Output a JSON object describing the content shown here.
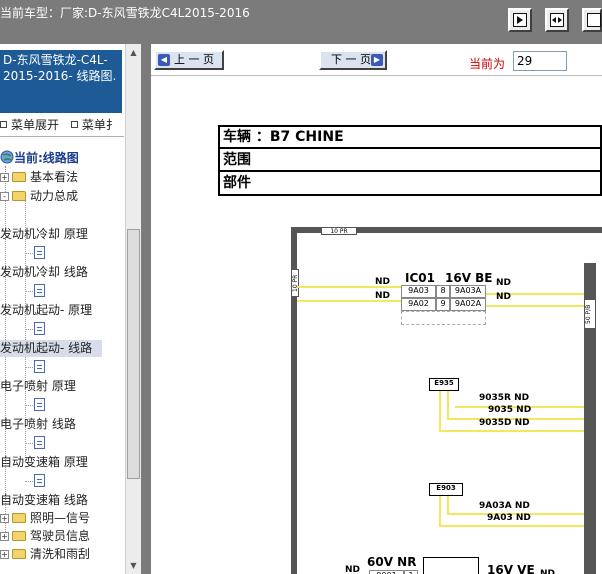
{
  "window": {
    "title": "当前车型：厂家:D-东风雪铁龙C4L2015-2016"
  },
  "toolbar": {
    "icons": [
      "fit-page-icon",
      "fit-width-icon",
      "fullscreen-icon"
    ]
  },
  "sidebar": {
    "header": "D-东风雪铁龙-C4L-2015-2016- 线路图.",
    "expand_label": "菜单展开",
    "collapse_label": "菜单扌",
    "tree": [
      {
        "label": "当前:线路图",
        "type": "root"
      },
      {
        "label": "基本看法",
        "type": "folder",
        "toggle": "+"
      },
      {
        "label": "动力总成",
        "type": "folder",
        "toggle": "-"
      },
      {
        "label": "发动机冷却 原理",
        "type": "item"
      },
      {
        "label": "发动机冷却 线路",
        "type": "item"
      },
      {
        "label": "发动机起动- 原理",
        "type": "item"
      },
      {
        "label": "发动机起动- 线路",
        "type": "item",
        "selected": true
      },
      {
        "label": "电子喷射 原理",
        "type": "item"
      },
      {
        "label": "电子喷射 线路",
        "type": "item"
      },
      {
        "label": "自动变速箱 原理",
        "type": "item"
      },
      {
        "label": "自动变速箱 线路",
        "type": "item"
      },
      {
        "label": "照明—信号",
        "type": "folder",
        "toggle": "+"
      },
      {
        "label": "驾驶员信息",
        "type": "folder",
        "toggle": "+"
      },
      {
        "label": "清洗和雨刮",
        "type": "folder",
        "toggle": "+"
      }
    ]
  },
  "nav": {
    "prev_label": "上 一 页",
    "next_label": "下 一 页",
    "current_label": "当前为",
    "current_page": "29"
  },
  "document": {
    "vehicle_line": "车辆 ：B7 CHINE",
    "scope_line": "范围",
    "part_line": "部件",
    "diagram": {
      "fuse_top": "10 PR",
      "fuse_left": "10 PR",
      "fuse_right": "50 P/B",
      "ic01": "IC01",
      "v16_be": "16V BE",
      "nd": "ND",
      "conn_rows": [
        [
          "9A03",
          "8",
          "9A03A"
        ],
        [
          "9A02",
          "9",
          "9A02A"
        ]
      ],
      "e935": "E935",
      "e935_wires": [
        "9035R ND",
        "9035 ND",
        "9035D ND"
      ],
      "e903": "E903",
      "e903_wires": [
        "9A03A ND",
        "9A03 ND"
      ],
      "v60_nr": "60V NR",
      "v16_ve": "16V VE",
      "bottom_cells": [
        "9001",
        "1"
      ]
    }
  }
}
